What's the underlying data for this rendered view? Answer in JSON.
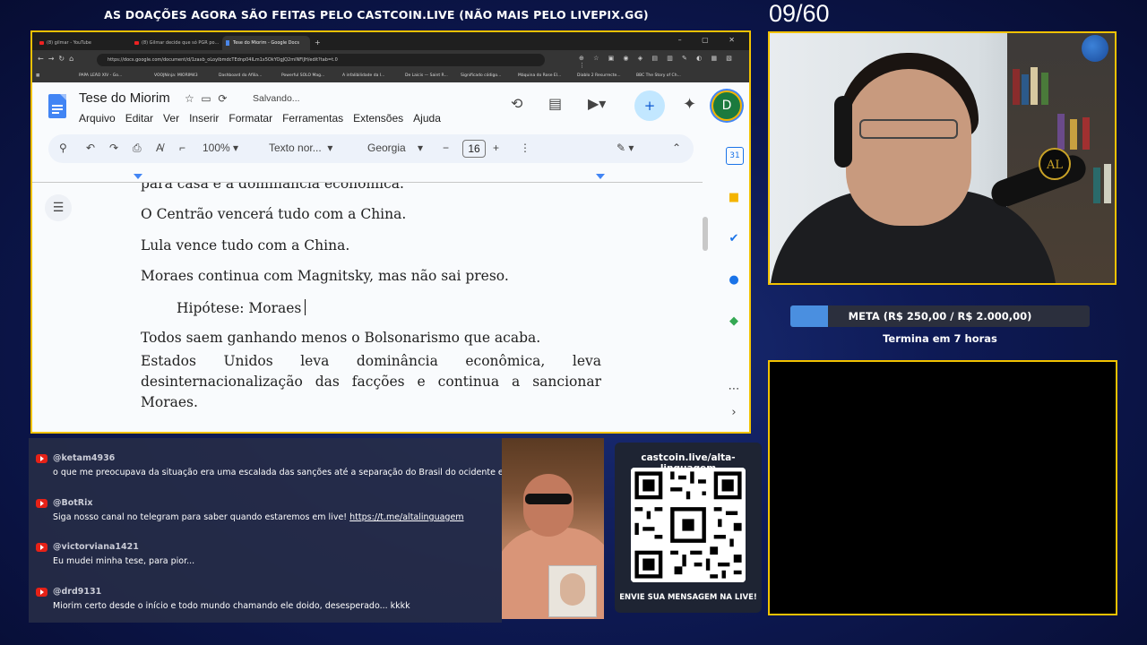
{
  "overlay": {
    "banner": "AS DOAÇÕES AGORA SÃO FEITAS PELO CASTCOIN.LIVE (NÃO MAIS PELO LIVEPIX.GG)",
    "counter": "09/60",
    "goal_label": "META (R$ 250,00 / R$ 2.000,00)",
    "goal_progress": 0.125,
    "goal_fill_color": "#4a8fe0",
    "goal_ends": "Termina em 7 horas",
    "qr_title": "castcoin.live/alta-linguagem",
    "qr_footer": "ENVIE SUA MENSAGEM NA LIVE!",
    "cam_logo": "AL",
    "border_color": "#f2c200"
  },
  "browser": {
    "tabs": [
      {
        "label": "(8) gilmar - YouTube",
        "active": false
      },
      {
        "label": "(8) Gilmar decide que só PGR po...",
        "active": false
      },
      {
        "label": "Tese do Miorim - Google Docs",
        "active": true
      }
    ],
    "url": "https://docs.google.com/document/d/1zaxb_oLoyibmdcTEdnp04ILm1x5OkYOgJQ2mlNFlJH/edit?tab=t.0",
    "bookmarks": [
      "PAPA LEÃO XIV - Go...",
      "VOOJNinja: MIORIM43",
      "Dashboard do Afilia...",
      "Powerful SOLO Mag...",
      "A infalibilidade da I...",
      "De Laicis — Saint R...",
      "Significado código...",
      "Máquina do Rose El...",
      "Diablo 2 Resurrecte...",
      "BBC The Story of Ch..."
    ],
    "window_controls": "– ▢ ✕"
  },
  "docs": {
    "title": "Tese do Miorim",
    "status": "Salvando...",
    "menus": [
      "Arquivo",
      "Editar",
      "Ver",
      "Inserir",
      "Formatar",
      "Ferramentas",
      "Extensões",
      "Ajuda"
    ],
    "zoom": "100%",
    "style": "Texto nor...",
    "font": "Georgia",
    "font_size": "16",
    "avatar_letter": "D",
    "paragraphs": {
      "p0": "para casa e a dominância econômica.",
      "p1": "O Centrão vencerá tudo com a China.",
      "p2": "Lula vence tudo com a China.",
      "p3": "Moraes continua com Magnitsky, mas não sai preso.",
      "p4": "Hipótese: Moraes",
      "p5": "Todos saem ganhando menos o Bolsonarismo que acaba.",
      "p6": "Estados Unidos leva dominância econômica, leva desinternacionalização das facções e continua a sancionar Moraes."
    }
  },
  "chat": [
    {
      "user": "@ketam4936",
      "text": "o que me preocupava da situação era uma escalada das sanções até a separação do Brasil do ocidente em questõ"
    },
    {
      "user": "@BotRix",
      "text": "Siga nosso canal no telegram para saber quando estaremos em live!",
      "link": "https://t.me/altalinguagem"
    },
    {
      "user": "@victorviana1421",
      "text": "Eu mudei minha tese, para pior..."
    },
    {
      "user": "@drd9131",
      "text": "Miorim certo desde o início e todo mundo chamando ele doido, desesperado... kkkk"
    }
  ]
}
